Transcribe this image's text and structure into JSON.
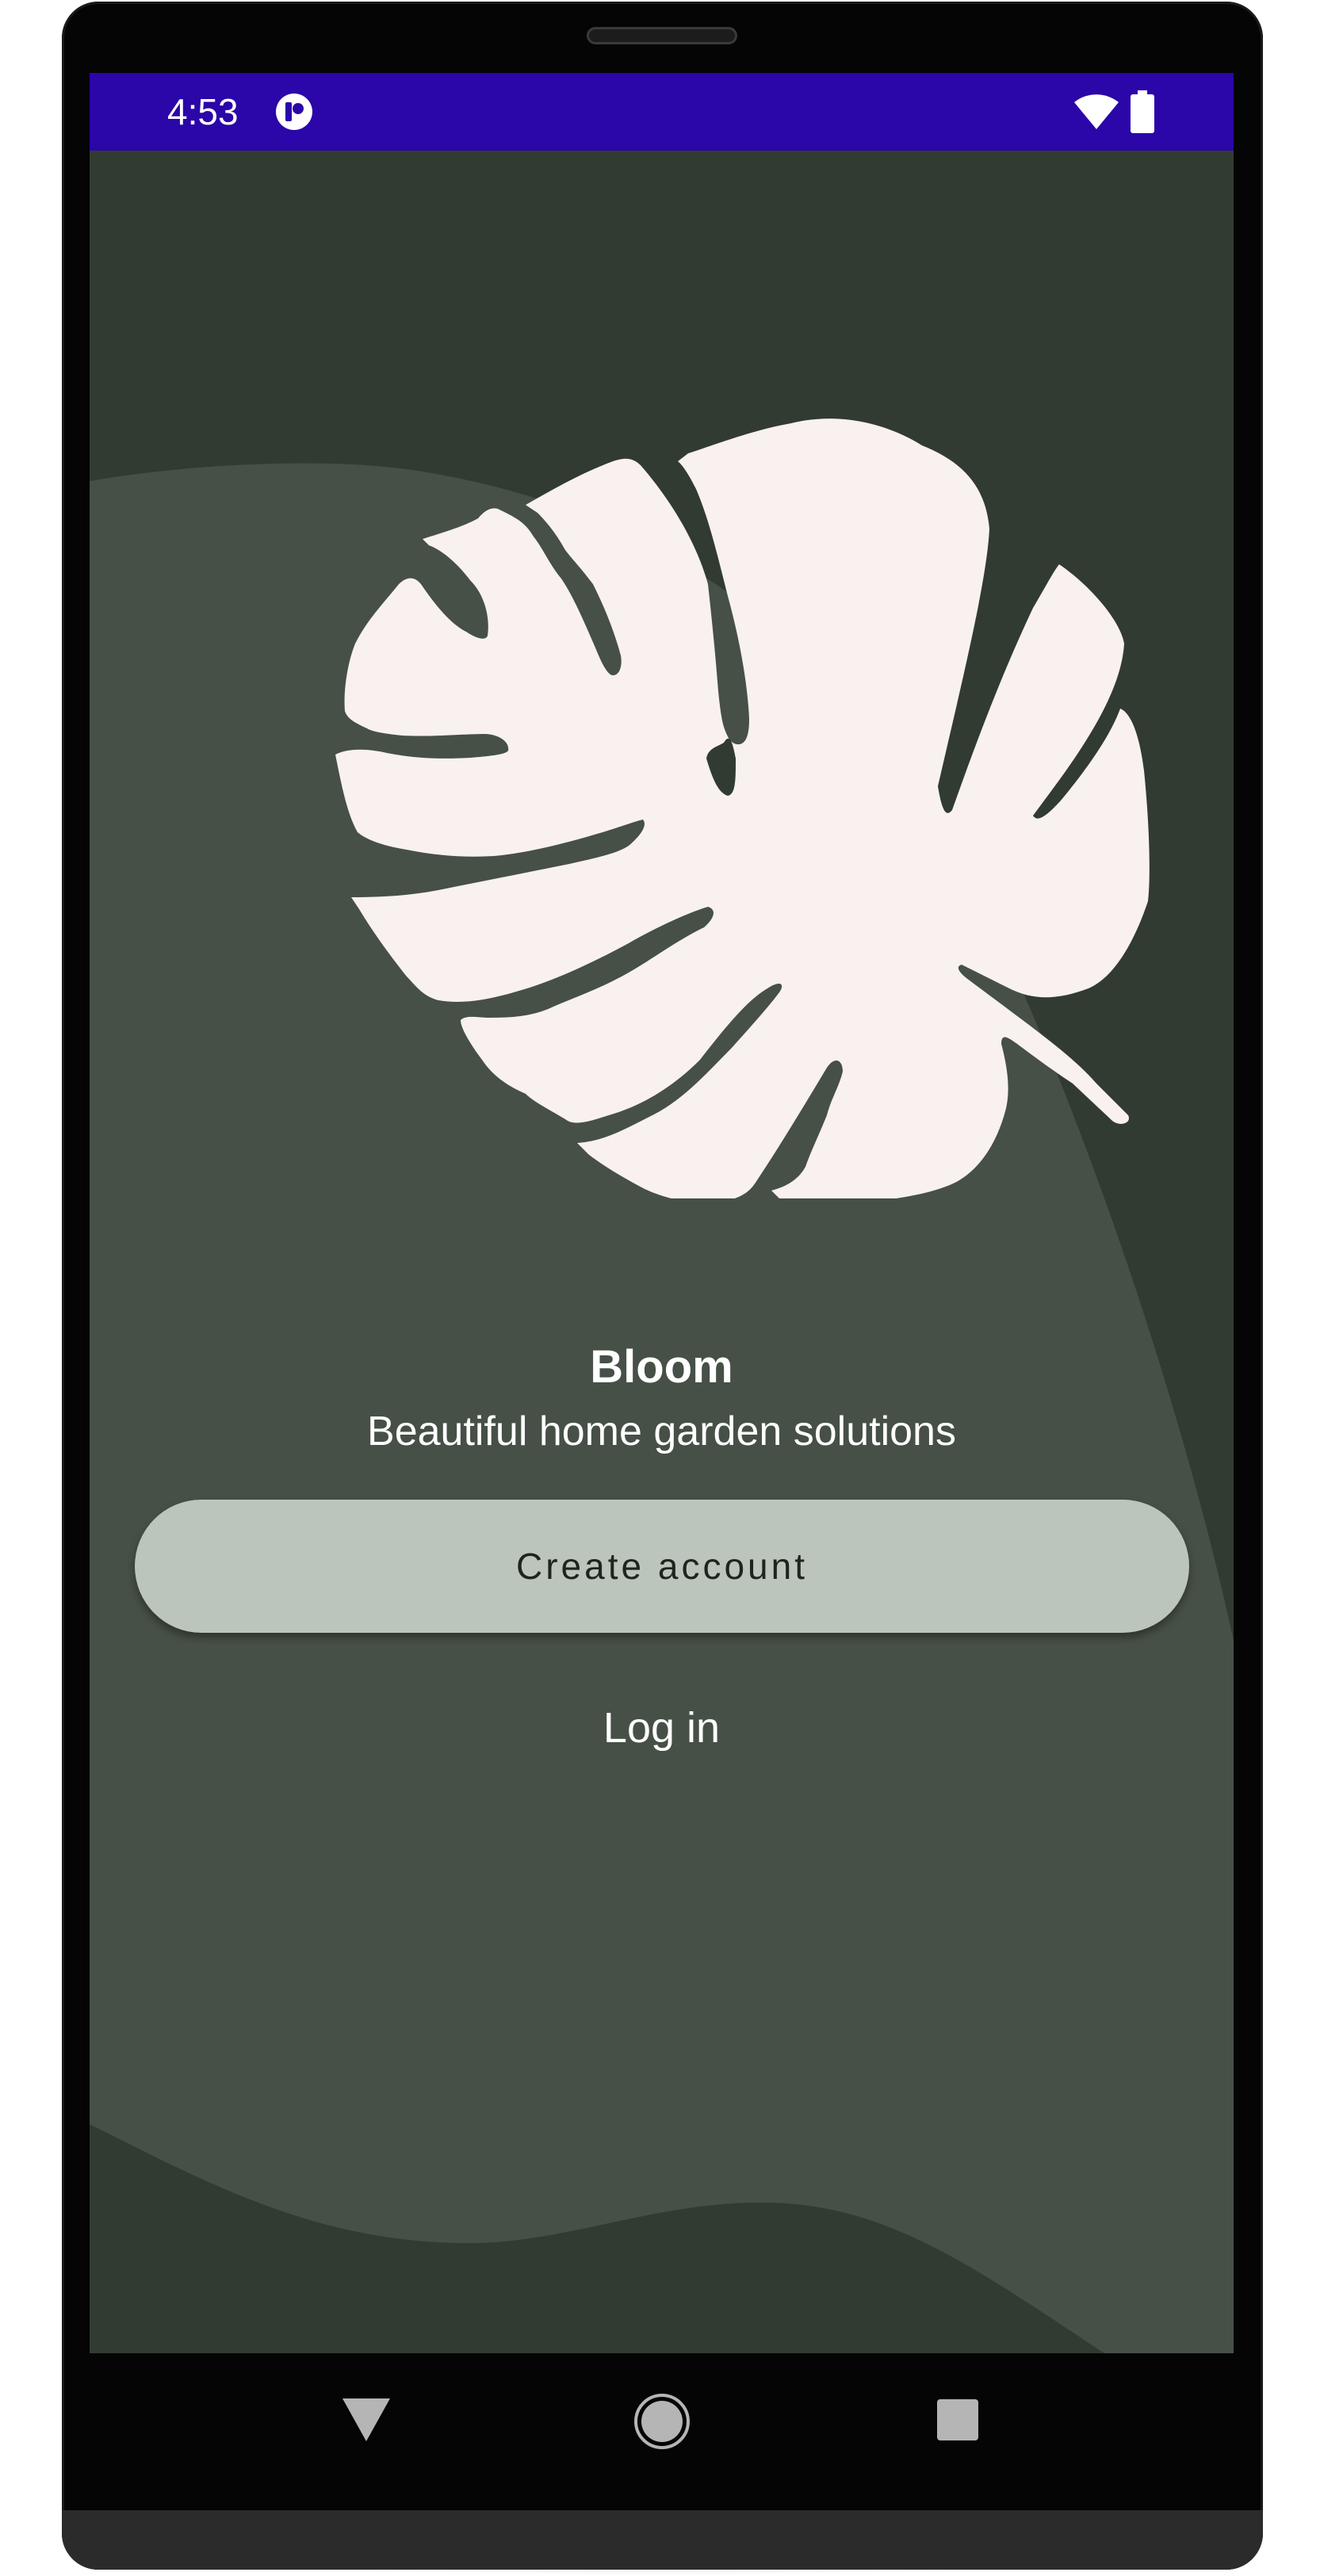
{
  "status_bar": {
    "time": "4:53",
    "background_color": "#2b06a8",
    "icons": [
      "app-notification-icon",
      "wifi-icon",
      "battery-icon"
    ]
  },
  "app": {
    "title": "Bloom",
    "subtitle": "Beautiful home garden solutions",
    "illustration": "monstera-leaf-icon",
    "colors": {
      "background_dark": "#323b31",
      "background_light": "#465046",
      "leaf": "#f8f1ef",
      "button": "#bcc5bb"
    }
  },
  "actions": {
    "create_account_label": "Create account",
    "login_label": "Log in"
  },
  "nav_bar": {
    "icons": [
      "back-icon",
      "home-icon",
      "recents-icon"
    ]
  }
}
